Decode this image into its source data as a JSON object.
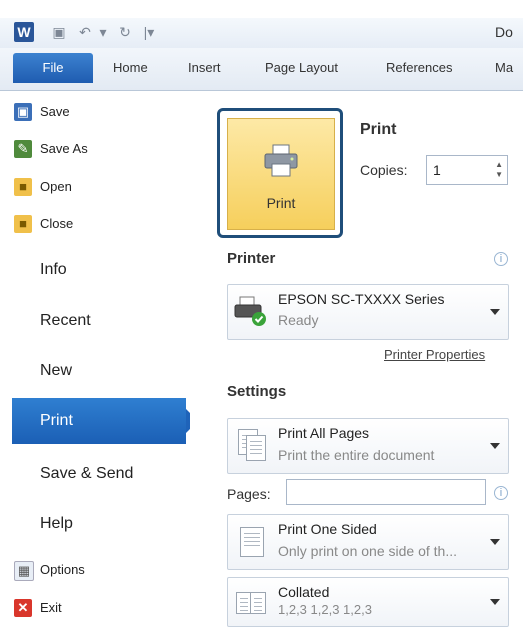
{
  "qat": {
    "word_logo": "W",
    "doc_title": "Do"
  },
  "tabs": [
    "File",
    "Home",
    "Insert",
    "Page Layout",
    "References",
    "Ma"
  ],
  "nav": {
    "save": "Save",
    "save_as": "Save As",
    "open": "Open",
    "close": "Close",
    "info": "Info",
    "recent": "Recent",
    "new": "New",
    "print": "Print",
    "save_send": "Save & Send",
    "help": "Help",
    "options": "Options",
    "exit": "Exit"
  },
  "print_panel": {
    "print_button_label": "Print",
    "title": "Print",
    "copies_label": "Copies:",
    "copies_value": "1"
  },
  "printer": {
    "header": "Printer",
    "name": "EPSON SC-TXXXX Series",
    "status": "Ready",
    "properties_link": "Printer Properties"
  },
  "settings": {
    "header": "Settings",
    "pages_option_title": "Print All Pages",
    "pages_option_sub": "Print the entire document",
    "pages_label": "Pages:",
    "pages_value": "",
    "sided_title": "Print One Sided",
    "sided_sub": "Only print on one side of th...",
    "collate_title": "Collated",
    "collate_sub": "1,2,3   1,2,3   1,2,3"
  },
  "colors": {
    "accent": "#1f5cb0",
    "print_button_fill": "#f6cf5c",
    "print_button_border": "#1f4e7a"
  }
}
